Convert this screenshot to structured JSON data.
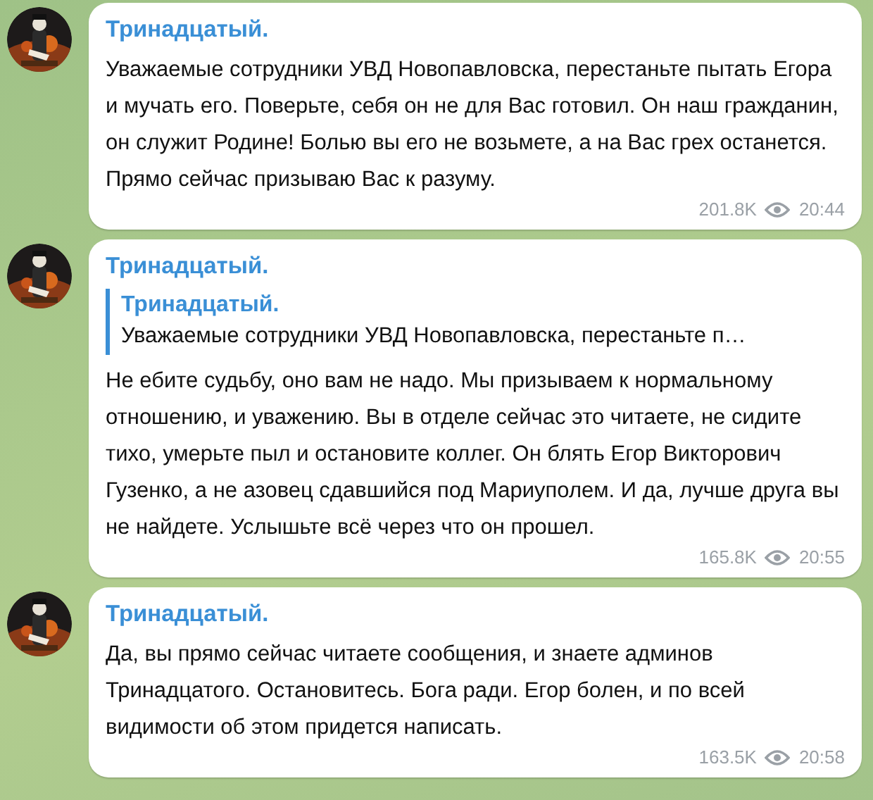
{
  "messages": [
    {
      "author": "Тринадцатый.",
      "text": "Уважаемые сотрудники УВД Новопавловска, перестаньте пытать Егора и мучать его. Поверьте, себя он не для Вас готовил. Он наш гражданин, он служит Родине! Болью вы его не возьмете, а на Вас грех останется. Прямо сейчас призываю Вас к разуму.",
      "views": "201.8K",
      "time": "20:44"
    },
    {
      "author": "Тринадцатый.",
      "reply": {
        "author": "Тринадцатый.",
        "text": "Уважаемые сотрудники УВД Новопавловска, перестаньте п…"
      },
      "text": "Не ебите судьбу, оно вам не надо. Мы призываем к нормальному отношению, и уважению. Вы в отделе сейчас это читаете, не сидите тихо, умерьте пыл и остановите коллег. Он блять Егор Викторович Гузенко, а не азовец сдавшийся под Мариуполем. И да, лучше друга вы не найдете. Услышьте всё через что он прошел.",
      "views": "165.8K",
      "time": "20:55"
    },
    {
      "author": "Тринадцатый.",
      "text": "Да, вы прямо сейчас читаете сообщения, и знаете админов Тринадцатого. Остановитесь. Бога ради. Егор болен, и по всей видимости об этом придется написать.",
      "views": "163.5K",
      "time": "20:58"
    }
  ]
}
